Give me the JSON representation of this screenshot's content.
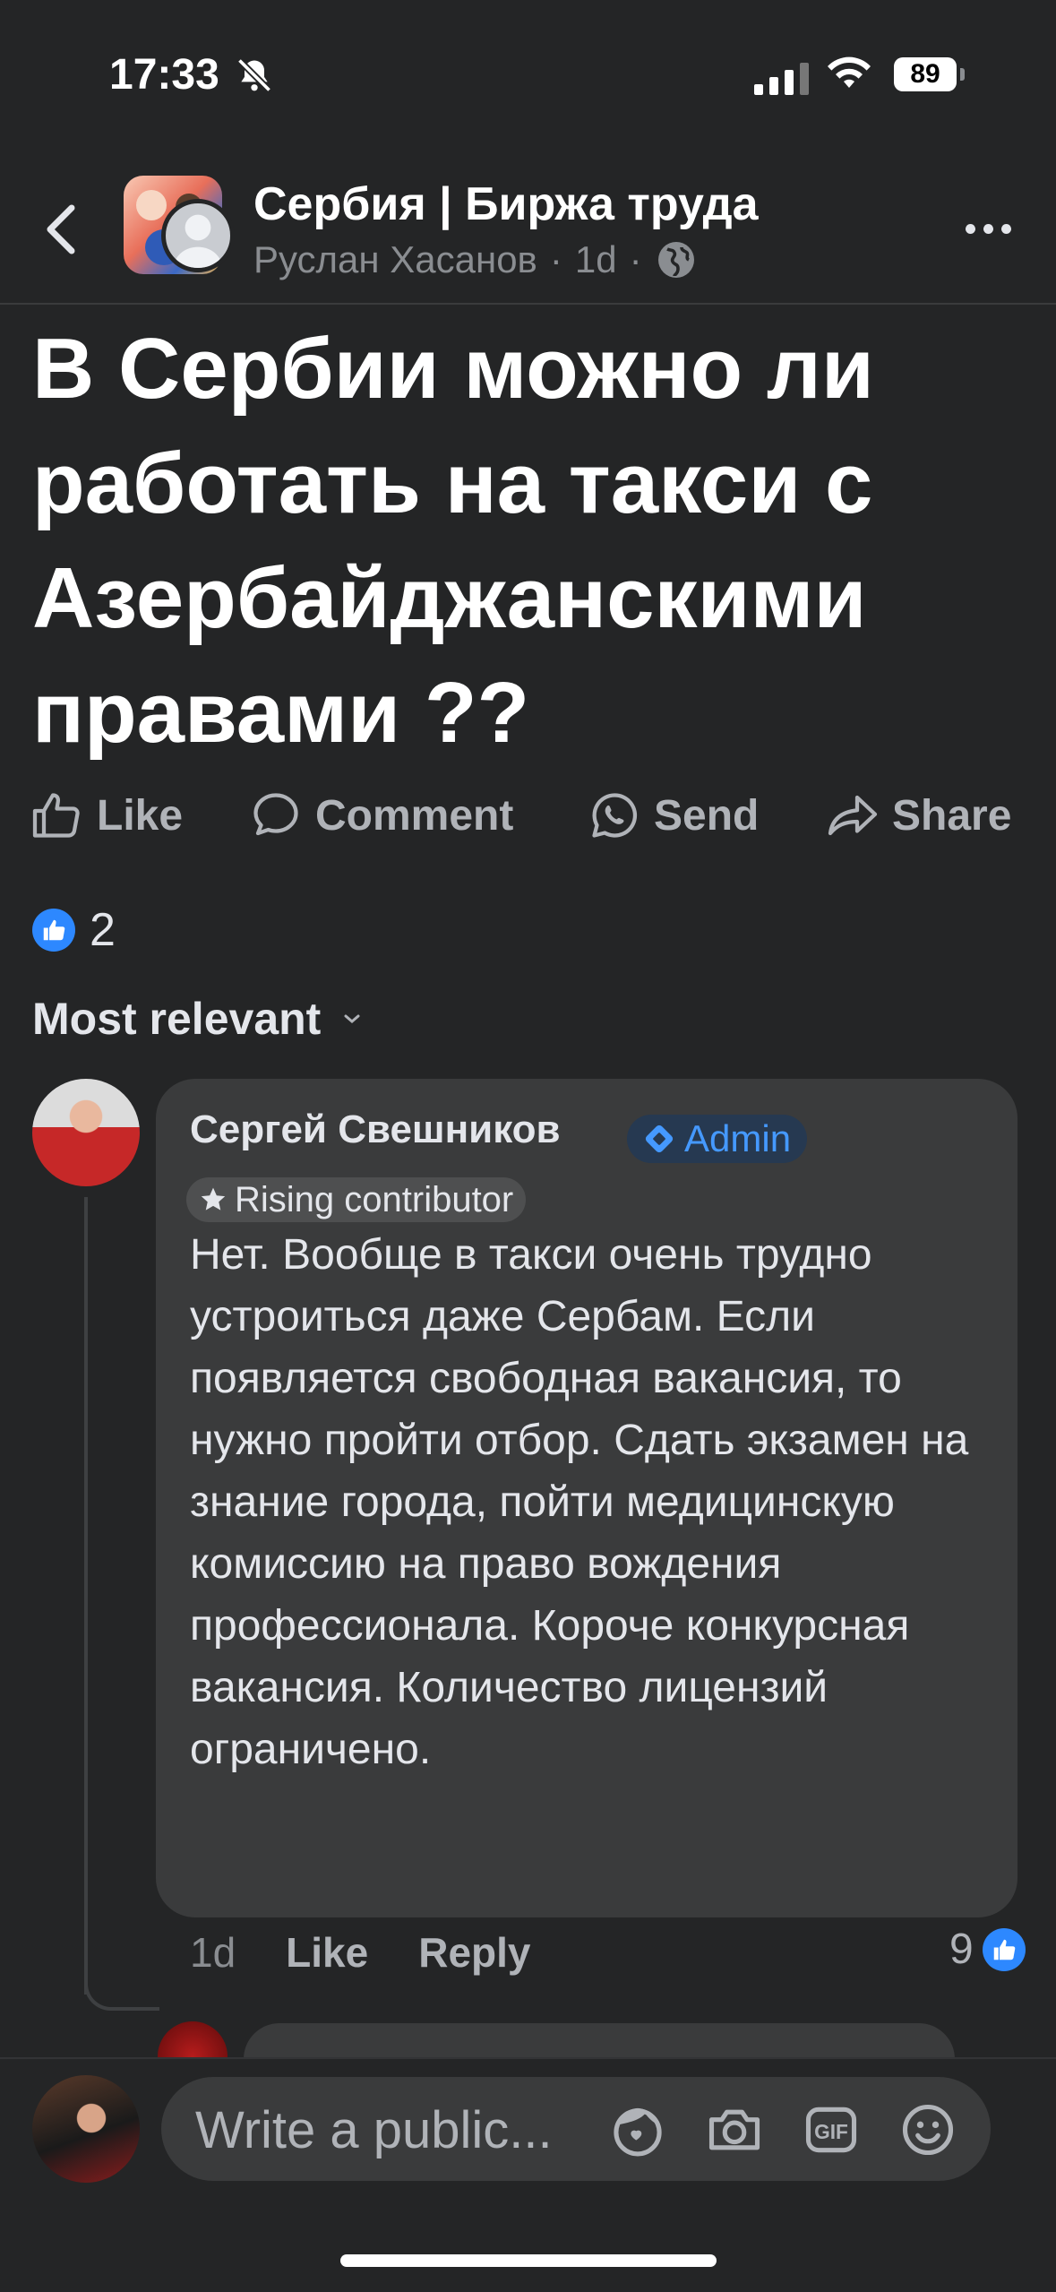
{
  "status_bar": {
    "time": "17:33",
    "battery": "89"
  },
  "header": {
    "group_name": "Сербия | Биржа труда",
    "author": "Руслан Хасанов",
    "age": "1d",
    "separator": "·"
  },
  "post": {
    "title": "В Сербии можно ли работать на такси с Азербайджанскими правами ??"
  },
  "actions": {
    "like": "Like",
    "comment": "Comment",
    "send": "Send",
    "share": "Share"
  },
  "reactions": {
    "count": "2"
  },
  "sort": {
    "label": "Most relevant"
  },
  "comment": {
    "author": "Сергей Свешников",
    "badge_admin": "Admin",
    "badge_contributor": "Rising contributor",
    "text": "Нет. Вообще в такси очень трудно устроиться даже Сербам. Если появляется свободная вакансия, то нужно пройти отбор. Сдать экзамен на знание города, пойти медицинскую комиссию на право вождения профессионала. Короче конкурсная вакансия. Количество лицензий ограничено.",
    "age": "1d",
    "like": "Like",
    "reply": "Reply",
    "likes_count": "9"
  },
  "composer": {
    "placeholder": "Write a public..."
  },
  "colors": {
    "accent": "#2d88ff",
    "background": "#242526",
    "bubble": "#3a3b3c"
  }
}
